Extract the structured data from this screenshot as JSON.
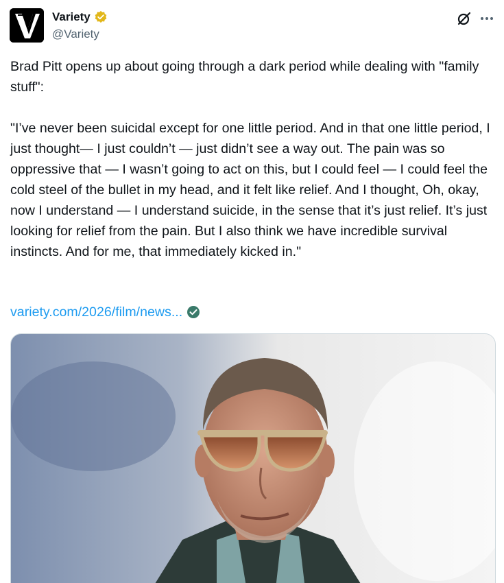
{
  "author": {
    "display_name": "Variety",
    "handle": "@Variety",
    "verified": true,
    "verified_color": "#e2b719",
    "logo_letter": "V"
  },
  "tweet": {
    "text": "Brad Pitt opens up about going through a dark period while dealing with \"family stuff\":\n\n\"I’ve never been suicidal except for one little period. And in that one little period, I just thought— I just couldn’t — just didn’t see a way out. The pain was so oppressive that — I wasn’t going to act on this, but I could feel — I could feel the cold steel of the bullet in my head, and it felt like relief. And I thought, Oh, okay, now I understand — I understand suicide, in the sense that it’s just relief. It’s just looking for relief from the pain. But I also think we have incredible survival instincts. And for me, that immediately kicked in.\"",
    "link_text": "variety.com/2026/film/news...",
    "link_color": "#1d9bf0"
  },
  "icons": {
    "verified": "verified-badge-icon",
    "grok": "grok-icon",
    "more": "more-options-icon",
    "link_check": "check-circle-icon"
  },
  "media": {
    "description_icon": "photo-image"
  }
}
